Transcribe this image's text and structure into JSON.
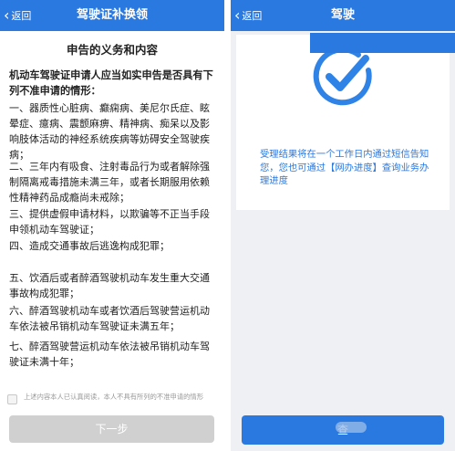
{
  "left": {
    "back_label": "返回",
    "title": "驾驶证补换领",
    "heading": "申告的义务和内容",
    "lead": "机动车驾驶证申请人应当如实申告是否具有下列不准申请的情形：",
    "items": [
      "一、器质性心脏病、癫痫病、美尼尔氏症、眩晕症、癔病、震颤麻痹、精神病、痴呆以及影响肢体活动的神经系统疾病等妨碍安全驾驶疾病；",
      "二、三年内有吸食、注射毒品行为或者解除强制隔离戒毒措施未满三年，或者长期服用依赖性精神药品成瘾尚未戒除；",
      "三、提供虚假申请材料，以欺骗等不正当手段申领机动车驾驶证；",
      "四、造成交通事故后逃逸构成犯罪；",
      "五、饮酒后或者醉酒驾驶机动车发生重大交通事故构成犯罪；",
      "六、醉酒驾驶机动车或者饮酒后驾驶营运机动车依法被吊销机动车驾驶证未满五年；",
      "七、醉酒驾驶营运机动车依法被吊销机动车驾驶证未满十年；"
    ],
    "agree_text": "上述内容本人已认真阅读，本人不具有所列的不准申请的情形",
    "next_button": "下一步"
  },
  "right": {
    "back_label": "返回",
    "title": "驾驶",
    "result_text": "受理结果将在一个工作日内通过短信告知您，您也可通过【网办进度】查询业务办理进度",
    "query_button": "查"
  },
  "colors": {
    "brand_blue": "#2a79e0",
    "check_blue": "#2f82e6",
    "disabled_gray": "#d0d0d0",
    "page_gray": "#eef0f3"
  },
  "icons": {
    "success": "check-circle-icon",
    "back": "chevron-left-icon"
  }
}
